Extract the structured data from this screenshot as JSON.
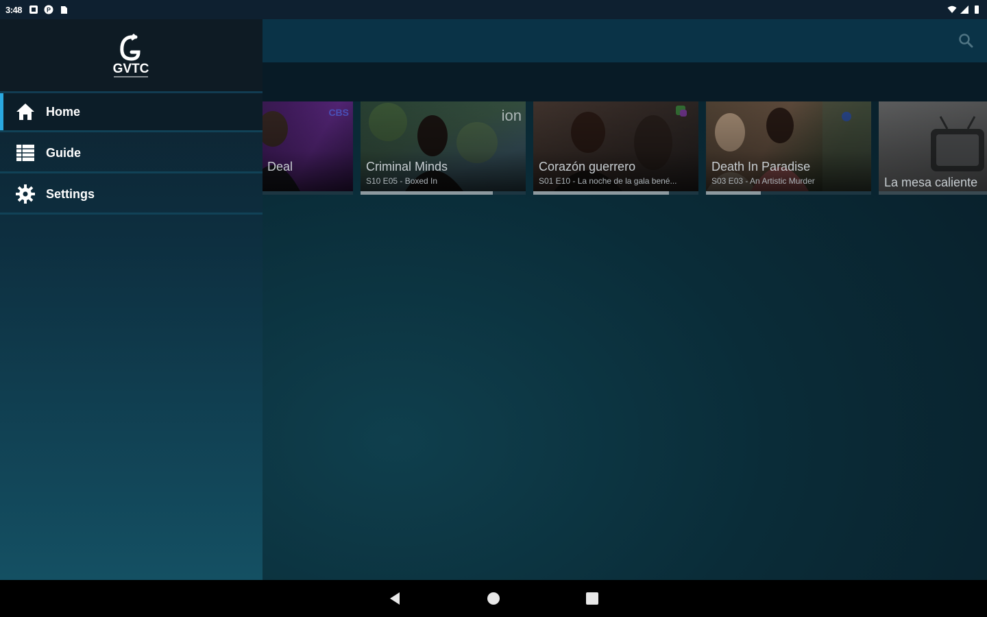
{
  "status_bar": {
    "time": "3:48",
    "left_icons": [
      "notification-icon",
      "app-icon",
      "clipboard-icon"
    ],
    "right_icons": [
      "wifi-icon",
      "signal-icon",
      "battery-icon"
    ]
  },
  "drawer": {
    "brand": "GVTC",
    "items": [
      {
        "label": "Home",
        "icon": "home-icon",
        "active": true
      },
      {
        "label": "Guide",
        "icon": "guide-icon",
        "active": false
      },
      {
        "label": "Settings",
        "icon": "gear-icon",
        "active": false
      }
    ]
  },
  "toolbar": {
    "search_icon": "search-icon"
  },
  "cards": [
    {
      "title": "Deal",
      "subtitle": "",
      "channel": "CBS",
      "progress": 0.36
    },
    {
      "title": "Criminal Minds",
      "subtitle": "S10 E05 - Boxed In",
      "channel": "ion",
      "progress": 0.8
    },
    {
      "title": "Corazón guerrero",
      "subtitle": "S01 E10 - La noche de la gala bené...",
      "channel": "",
      "progress": 0.82
    },
    {
      "title": "Death In Paradise",
      "subtitle": "S03 E03 - An Artistic Murder",
      "channel": "",
      "progress": 0.33
    },
    {
      "title": "La mesa caliente",
      "subtitle": "",
      "channel": "",
      "progress": 0.0
    }
  ],
  "colors": {
    "accent": "#2aa8e0",
    "toolbar": "#0a3347",
    "drawer_top": "#0e1e2a",
    "drawer_bottom": "#145063"
  }
}
